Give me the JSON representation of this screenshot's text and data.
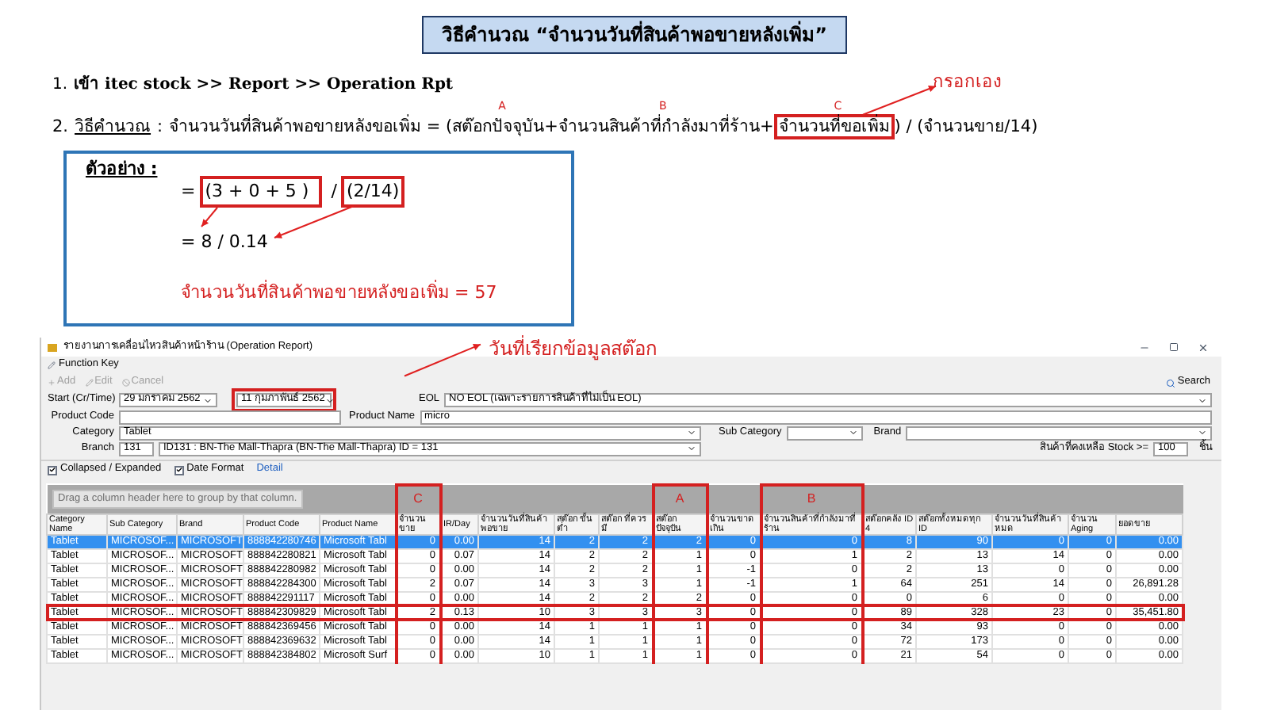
{
  "title": "วิธีคำนวณ “จำนวนวันที่สินค้าพอขายหลังเพิ่ม”",
  "step1": {
    "number": "1.",
    "text": "เข้า itec stock >> Report >> Operation Rpt"
  },
  "step2": {
    "number": "2.",
    "label": "วิธีคำนวณ",
    "colon": ":",
    "callout": "กรอกเอง",
    "segments": [
      {
        "text": "จำนวนวันที่สินค้าพอขายหลังขอเพิ่ม = (",
        "boxed": false
      },
      {
        "text": "สต๊อกปัจจุบัน",
        "marker": "A",
        "boxed": false
      },
      {
        "text": "+",
        "boxed": false
      },
      {
        "text": "จำนวนสินค้าที่กำลังมาที่ร้าน",
        "marker": "B",
        "boxed": false
      },
      {
        "text": "+",
        "boxed": false
      },
      {
        "text": "จำนวนที่ขอเพิ่ม",
        "marker": "C",
        "boxed": true
      },
      {
        "text": ") / (จำนวนขาย/14)",
        "boxed": false
      }
    ]
  },
  "example": {
    "label": "ตัวอย่าง :",
    "line1": {
      "prefix": "=",
      "left": "(3 + 0 + 5 )",
      "op": "/",
      "right": "(2/14)"
    },
    "line2": "= 8 / 0.14",
    "result": "จำนวนวันที่สินค้าพอขายหลังขอเพิ่ม = 57"
  },
  "window": {
    "title": "รายงานการเคลื่อนไหวสินค้าหน้าร้าน (Operation Report)",
    "callout": "วันที่เรียกข้อมูลสต๊อก",
    "menu": "Function Key",
    "toolbar": [
      {
        "label": "Add",
        "disabled": true
      },
      {
        "label": "Edit",
        "disabled": true
      },
      {
        "label": "Cancel",
        "disabled": true
      }
    ],
    "search": "Search",
    "form": {
      "start_label": "Start (Cr/Time)",
      "date_from": "29   มกราคม   2562",
      "date_to": "11  กุมภาพันธ์  2562",
      "date_to_highlighted": true,
      "eol_label": "EOL",
      "eol_value": "NO EOL (เฉพาะรายการสินค้าที่ไม่เป็น EOL)",
      "product_code_label": "Product Code",
      "product_name_label": "Product Name",
      "product_name_value": "micro",
      "category_label": "Category",
      "category_value": "Tablet",
      "sub_category_label": "Sub Category",
      "brand_label": "Brand",
      "branch_label": "Branch",
      "branch_value": "131",
      "branch_desc": "ID131 : BN-The Mall-Thapra (BN-The Mall-Thapra) ID = 131",
      "stock_label": "สินค้าที่คงเหลือ Stock >=",
      "stock_value": "100",
      "stock_unit": "ชิ้น"
    },
    "options": [
      {
        "label": "Collapsed / Expanded",
        "checked": true
      },
      {
        "label": "Date Format",
        "checked": true
      }
    ],
    "detail_link": "Detail",
    "group_hint": "Drag a column header here to group by that column.",
    "table": {
      "columns": [
        {
          "label": "Category Name"
        },
        {
          "label": "Sub Category"
        },
        {
          "label": "Brand"
        },
        {
          "label": "Product Code"
        },
        {
          "label": "Product Name"
        },
        {
          "label": "จำนวนขาย",
          "marker": "C"
        },
        {
          "label": "IR/Day"
        },
        {
          "label": "จำนวนวันที่สินค้าพอขาย"
        },
        {
          "label": "สต๊อก ขั้นต่ำ"
        },
        {
          "label": "สต๊อก ที่ควรมี"
        },
        {
          "label": "สต๊อก ปัจจุบัน",
          "marker": "A"
        },
        {
          "label": "จำนวนขาดเกิน"
        },
        {
          "label": "จำนวนสินค้าที่กำลังมาที่ร้าน",
          "marker": "B"
        },
        {
          "label": "สต๊อกคลัง ID 4"
        },
        {
          "label": "สต๊อกทั้งหมดทุก ID"
        },
        {
          "label": "จำนวนวันที่สินค้าหมด"
        },
        {
          "label": "จำนวน Aging"
        },
        {
          "label": "ยอดขาย"
        }
      ],
      "rows": [
        {
          "selected": true,
          "highlighted": false,
          "cells": [
            "Tablet",
            "MICROSOF...",
            "MICROSOFT",
            "888842280746",
            "Microsoft Tabl",
            "0",
            "0.00",
            "14",
            "2",
            "2",
            "2",
            "0",
            "0",
            "8",
            "90",
            "0",
            "0",
            "0.00"
          ]
        },
        {
          "selected": false,
          "highlighted": false,
          "cells": [
            "Tablet",
            "MICROSOF...",
            "MICROSOFT",
            "888842280821",
            "Microsoft Tabl",
            "0",
            "0.07",
            "14",
            "2",
            "2",
            "1",
            "0",
            "1",
            "2",
            "13",
            "14",
            "0",
            "0.00"
          ]
        },
        {
          "selected": false,
          "highlighted": false,
          "cells": [
            "Tablet",
            "MICROSOF...",
            "MICROSOFT",
            "888842280982",
            "Microsoft Tabl",
            "0",
            "0.00",
            "14",
            "2",
            "2",
            "1",
            "-1",
            "0",
            "2",
            "13",
            "0",
            "0",
            "0.00"
          ]
        },
        {
          "selected": false,
          "highlighted": false,
          "cells": [
            "Tablet",
            "MICROSOF...",
            "MICROSOFT",
            "888842284300",
            "Microsoft Tabl",
            "2",
            "0.07",
            "14",
            "3",
            "3",
            "1",
            "-1",
            "1",
            "64",
            "251",
            "14",
            "0",
            "26,891.28"
          ]
        },
        {
          "selected": false,
          "highlighted": false,
          "cells": [
            "Tablet",
            "MICROSOF...",
            "MICROSOFT",
            "888842291117",
            "Microsoft Tabl",
            "0",
            "0.00",
            "14",
            "2",
            "2",
            "2",
            "0",
            "0",
            "0",
            "6",
            "0",
            "0",
            "0.00"
          ]
        },
        {
          "selected": false,
          "highlighted": true,
          "cells": [
            "Tablet",
            "MICROSOF...",
            "MICROSOFT",
            "888842309829",
            "Microsoft Tabl",
            "2",
            "0.13",
            "10",
            "3",
            "3",
            "3",
            "0",
            "0",
            "89",
            "328",
            "23",
            "0",
            "35,451.80"
          ]
        },
        {
          "selected": false,
          "highlighted": false,
          "cells": [
            "Tablet",
            "MICROSOF...",
            "MICROSOFT",
            "888842369456",
            "Microsoft Tabl",
            "0",
            "0.00",
            "14",
            "1",
            "1",
            "1",
            "0",
            "0",
            "34",
            "93",
            "0",
            "0",
            "0.00"
          ]
        },
        {
          "selected": false,
          "highlighted": false,
          "cells": [
            "Tablet",
            "MICROSOF...",
            "MICROSOFT",
            "888842369632",
            "Microsoft Tabl",
            "0",
            "0.00",
            "14",
            "1",
            "1",
            "1",
            "0",
            "0",
            "72",
            "173",
            "0",
            "0",
            "0.00"
          ]
        },
        {
          "selected": false,
          "highlighted": false,
          "cells": [
            "Tablet",
            "MICROSOF...",
            "MICROSOFT",
            "888842384802",
            "Microsoft Surf",
            "0",
            "0.00",
            "10",
            "1",
            "1",
            "1",
            "0",
            "0",
            "21",
            "54",
            "0",
            "0",
            "0.00"
          ]
        }
      ]
    }
  }
}
